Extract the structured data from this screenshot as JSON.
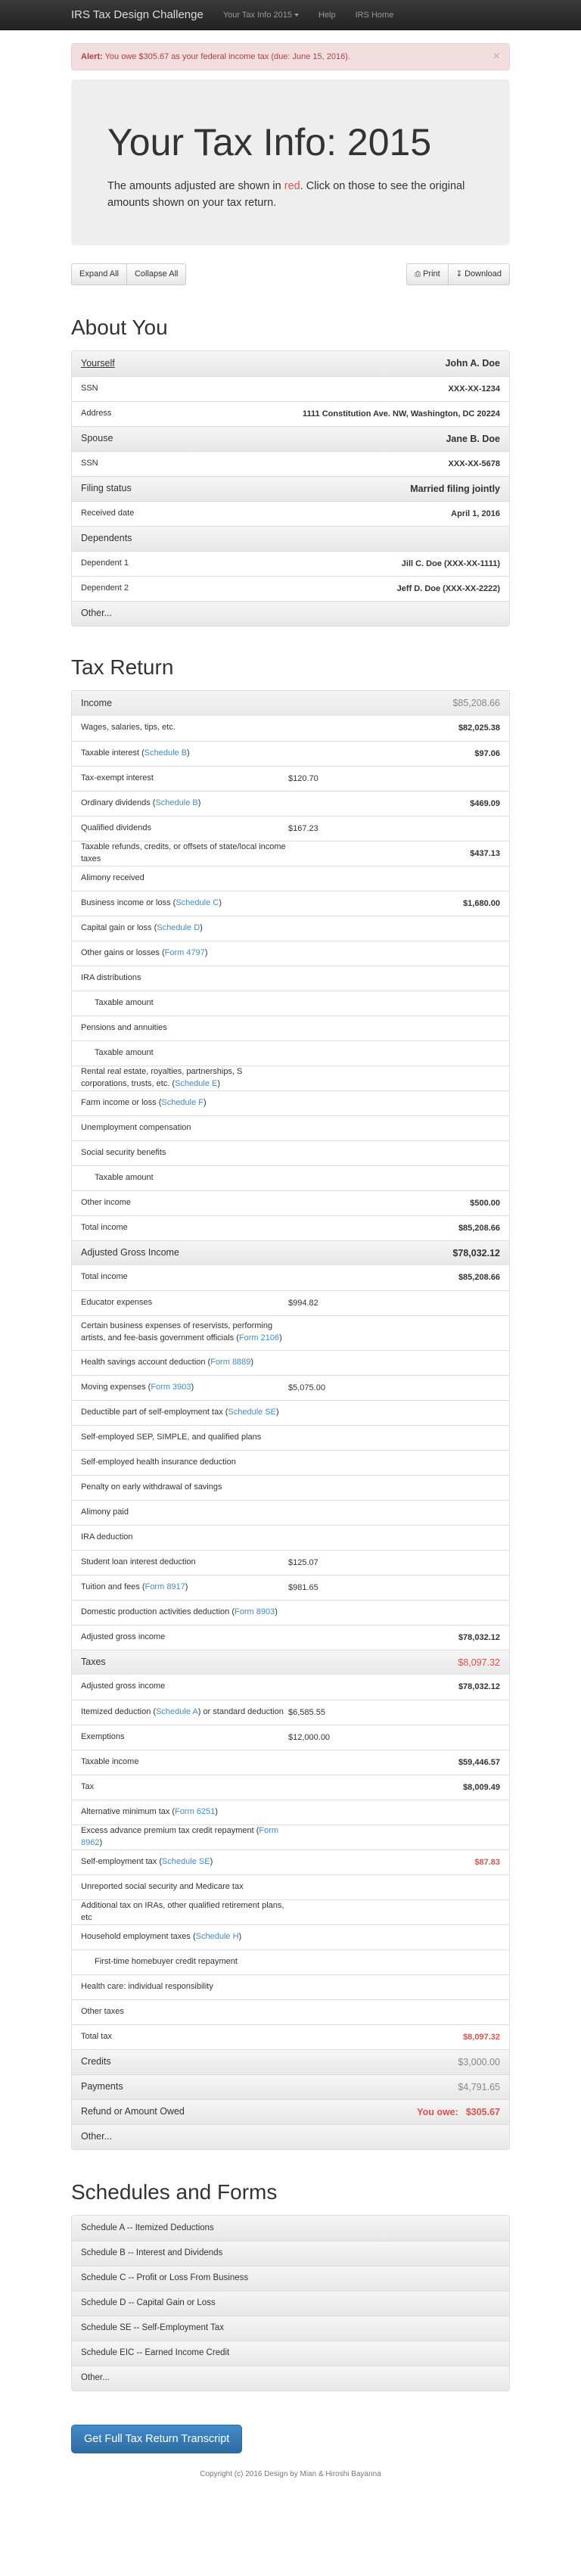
{
  "nav": {
    "brand": "IRS Tax Design Challenge",
    "items": [
      "Your Tax Info 2015",
      "Help",
      "IRS Home"
    ]
  },
  "alert": {
    "strong": "Alert:",
    "text": "You owe $305.67 as your federal income tax (due: June 15, 2016).",
    "close": "×"
  },
  "jumbo": {
    "title": "Your Tax Info: 2015",
    "text_before": "The amounts adjusted are shown in ",
    "red_word": "red",
    "text_after": ". Click on those to see the original amounts shown on your tax return."
  },
  "toolbar": {
    "expand": "Expand All",
    "collapse": "Collapse All",
    "print": "Print",
    "download": "Download"
  },
  "about": {
    "heading": "About You",
    "yourself_label": "Yourself",
    "yourself_name": "John A. Doe",
    "ssn_label": "SSN",
    "ssn1": "XXX-XX-1234",
    "address_label": "Address",
    "address": "1111 Constitution Ave. NW, Washington, DC 20224",
    "spouse_label": "Spouse",
    "spouse_name": "Jane B. Doe",
    "ssn2": "XXX-XX-5678",
    "filing_label": "Filing status",
    "filing_value": "Married filing jointly",
    "received_label": "Received date",
    "received_value": "April 1, 2016",
    "dependents_label": "Dependents",
    "dep1_label": "Dependent 1",
    "dep1_value": "Jill C. Doe (XXX-XX-1111)",
    "dep2_label": "Dependent 2",
    "dep2_value": "Jeff D. Doe (XXX-XX-2222)",
    "other": "Other..."
  },
  "tax": {
    "heading": "Tax Return",
    "income": {
      "title": "Income",
      "total": "$85,208.66",
      "rows": [
        {
          "label": "Wages, salaries, tips, etc.",
          "mid": "",
          "val": "$82,025.38"
        },
        {
          "label": "Taxable interest (",
          "link": "Schedule B",
          "label_end": ")",
          "mid": "",
          "val": "$97.06"
        },
        {
          "label": "Tax-exempt interest",
          "mid": "$120.70",
          "val": ""
        },
        {
          "label": "Ordinary dividends (",
          "link": "Schedule B",
          "label_end": ")",
          "mid": "",
          "val": "$469.09"
        },
        {
          "label": "Qualified dividends",
          "mid": "$167.23",
          "val": ""
        },
        {
          "label": "Taxable refunds, credits, or offsets of state/local income taxes",
          "mid": "",
          "val": "$437.13"
        },
        {
          "label": "Alimony received",
          "mid": "",
          "val": ""
        },
        {
          "label": "Business income or loss (",
          "link": "Schedule C",
          "label_end": ")",
          "mid": "",
          "val": "$1,680.00"
        },
        {
          "label": "Capital gain or loss (",
          "link": "Schedule D",
          "label_end": ")",
          "mid": "",
          "val": ""
        },
        {
          "label": "Other gains or losses (",
          "link": "Form 4797",
          "label_end": ")",
          "mid": "",
          "val": ""
        },
        {
          "label": "IRA distributions",
          "mid": "",
          "val": ""
        },
        {
          "label": "Taxable amount",
          "indent": true,
          "mid": "",
          "val": ""
        },
        {
          "label": "Pensions and annuities",
          "mid": "",
          "val": ""
        },
        {
          "label": "Taxable amount",
          "indent": true,
          "mid": "",
          "val": ""
        },
        {
          "label": "Rental real estate, royalties, partnerships, S corporations, trusts, etc. (",
          "link": "Schedule E",
          "label_end": ")",
          "mid": "",
          "val": ""
        },
        {
          "label": "Farm income or loss (",
          "link": "Schedule F",
          "label_end": ")",
          "mid": "",
          "val": ""
        },
        {
          "label": "Unemployment compensation",
          "mid": "",
          "val": ""
        },
        {
          "label": "Social security benefits",
          "mid": "",
          "val": ""
        },
        {
          "label": "Taxable amount",
          "indent": true,
          "mid": "",
          "val": ""
        },
        {
          "label": "Other income",
          "mid": "",
          "val": "$500.00"
        },
        {
          "label": "Total income",
          "mid": "",
          "val": "$85,208.66"
        }
      ]
    },
    "agi": {
      "title": "Adjusted Gross Income",
      "total": "$78,032.12",
      "rows": [
        {
          "label": "Total income",
          "mid": "",
          "val": "$85,208.66"
        },
        {
          "label": "Educator expenses",
          "mid": "$994.82",
          "val": ""
        },
        {
          "label": "Certain business expenses of reservists, performing artists, and fee-basis government officials (",
          "link": "Form 2106",
          "label_end": ")",
          "mid": "",
          "val": "",
          "tall": true
        },
        {
          "label": "Health savings account deduction (",
          "link": "Form 8889",
          "label_end": ")",
          "mid": "",
          "val": ""
        },
        {
          "label": "Moving expenses (",
          "link": "Form 3903",
          "label_end": ")",
          "mid": "$5,075.00",
          "val": ""
        },
        {
          "label": "Deductible part of self-employment tax (",
          "link": "Schedule SE",
          "label_end": ")",
          "mid": "",
          "val": ""
        },
        {
          "label": "Self-employed SEP, SIMPLE, and qualified plans",
          "mid": "",
          "val": ""
        },
        {
          "label": "Self-employed health insurance deduction",
          "mid": "",
          "val": ""
        },
        {
          "label": "Penalty on early withdrawal of savings",
          "mid": "",
          "val": ""
        },
        {
          "label": "Alimony paid",
          "mid": "",
          "val": ""
        },
        {
          "label": "IRA deduction",
          "mid": "",
          "val": ""
        },
        {
          "label": "Student loan interest deduction",
          "mid": "$125.07",
          "val": ""
        },
        {
          "label": "Tuition and fees (",
          "link": "Form 8917",
          "label_end": ")",
          "mid": "$981.65",
          "val": ""
        },
        {
          "label": "Domestic production activities deduction (",
          "link": "Form 8903",
          "label_end": ")",
          "mid": "",
          "val": ""
        },
        {
          "label": "Adjusted gross income",
          "mid": "",
          "val": "$78,032.12"
        }
      ]
    },
    "taxes": {
      "title": "Taxes",
      "total": "$8,097.32",
      "rows": [
        {
          "label": "Adjusted gross income",
          "mid": "",
          "val": "$78,032.12"
        },
        {
          "label": "Itemized deduction (",
          "link": "Schedule A",
          "label_end": ") or standard deduction",
          "mid": "$6,585.55",
          "val": ""
        },
        {
          "label": "Exemptions",
          "mid": "$12,000.00",
          "val": ""
        },
        {
          "label": "Taxable income",
          "mid": "",
          "val": "$59,446.57"
        },
        {
          "label": "Tax",
          "mid": "",
          "val": "$8,009.49"
        },
        {
          "label": "Alternative minimum tax (",
          "link": "Form 6251",
          "label_end": ")",
          "mid": "",
          "val": ""
        },
        {
          "label": "Excess advance premium tax credit repayment (",
          "link": "Form 8962",
          "label_end": ")",
          "mid": "",
          "val": ""
        },
        {
          "label": "Self-employment tax (",
          "link": "Schedule SE",
          "label_end": ")",
          "mid": "",
          "val": "$87.83",
          "neg": true
        },
        {
          "label": "Unreported social security and Medicare tax",
          "mid": "",
          "val": ""
        },
        {
          "label": "Additional tax on IRAs, other qualified retirement plans, etc",
          "mid": "",
          "val": ""
        },
        {
          "label": "Household employment taxes (",
          "link": "Schedule H",
          "label_end": ")",
          "mid": "",
          "val": ""
        },
        {
          "label": "First-time homebuyer credit repayment",
          "indent": true,
          "mid": "",
          "val": ""
        },
        {
          "label": "Health care: individual responsibility",
          "mid": "",
          "val": ""
        },
        {
          "label": "Other taxes",
          "mid": "",
          "val": ""
        },
        {
          "label": "Total tax",
          "mid": "",
          "val": "$8,097.32",
          "neg": true
        }
      ]
    },
    "credits": {
      "title": "Credits",
      "total": "$3,000.00"
    },
    "payments": {
      "title": "Payments",
      "total": "$4,791.65"
    },
    "refund": {
      "title": "Refund or Amount Owed",
      "owe_label": "You owe:",
      "total": "$305.67"
    },
    "other": "Other..."
  },
  "forms": {
    "heading": "Schedules and Forms",
    "items": [
      "Schedule A -- Itemized Deductions",
      "Schedule B -- Interest and Dividends",
      "Schedule C -- Profit or Loss From Business",
      "Schedule D -- Capital Gain or Loss",
      "Schedule SE -- Self-Employment Tax",
      "Schedule EIC -- Earned Income Credit",
      "Other..."
    ]
  },
  "cta": "Get Full Tax Return Transcript",
  "footer": "Copyright (c) 2016 Design by Mian & Hiroshi Bayanna"
}
